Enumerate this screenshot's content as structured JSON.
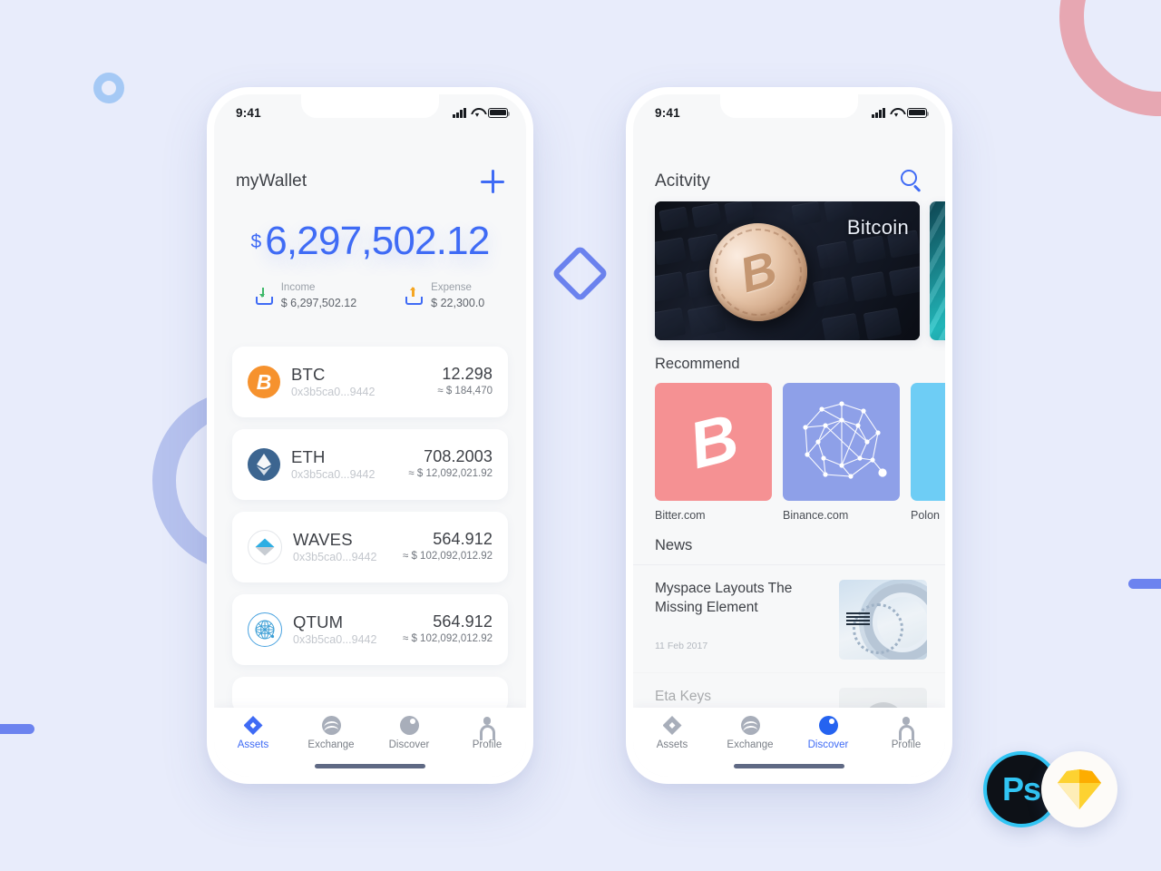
{
  "phone1": {
    "status": {
      "time": "9:41",
      "signal_icon": "cellular-bars-icon",
      "wifi_icon": "wifi-icon",
      "battery_icon": "battery-full-icon"
    },
    "header": {
      "title": "myWallet",
      "add_icon": "plus-icon"
    },
    "balance": {
      "currency_symbol": "$",
      "amount": "6,297,502.12"
    },
    "summary": [
      {
        "icon": "income-download-icon",
        "label": "Income",
        "value": "$ 6,297,502.12"
      },
      {
        "icon": "expense-upload-icon",
        "label": "Expense",
        "value": "$ 22,300.0"
      }
    ],
    "assets": [
      {
        "icon": "bitcoin-coin-icon",
        "symbol": "BTC",
        "address": "0x3b5ca0...9442",
        "amount": "12.298",
        "usd": "≈ $ 184,470"
      },
      {
        "icon": "ethereum-coin-icon",
        "symbol": "ETH",
        "address": "0x3b5ca0...9442",
        "amount": "708.2003",
        "usd": "≈ $ 12,092,021.92"
      },
      {
        "icon": "waves-coin-icon",
        "symbol": "WAVES",
        "address": "0x3b5ca0...9442",
        "amount": "564.912",
        "usd": "≈ $ 102,092,012.92"
      },
      {
        "icon": "qtum-coin-icon",
        "symbol": "QTUM",
        "address": "0x3b5ca0...9442",
        "amount": "564.912",
        "usd": "≈ $ 102,092,012.92"
      }
    ],
    "tabs": [
      {
        "icon": "assets-diamond-icon",
        "label": "Assets",
        "active": true
      },
      {
        "icon": "exchange-waves-icon",
        "label": "Exchange",
        "active": false
      },
      {
        "icon": "discover-compass-icon",
        "label": "Discover",
        "active": false
      },
      {
        "icon": "profile-person-icon",
        "label": "Profile",
        "active": false
      }
    ]
  },
  "phone2": {
    "status": {
      "time": "9:41",
      "signal_icon": "cellular-bars-icon",
      "wifi_icon": "wifi-icon",
      "battery_icon": "battery-full-icon"
    },
    "header": {
      "title": "Acitvity",
      "search_icon": "search-icon"
    },
    "hero": [
      {
        "caption": "Bitcoin",
        "image": "bitcoin-coin-on-keyboard-photo"
      },
      {
        "caption": "",
        "image": "teal-abstract-photo"
      }
    ],
    "recommend": {
      "section_title": "Recommend",
      "items": [
        {
          "icon": "bitcoin-glyph-icon",
          "label": "Bitter.com",
          "color": "#f59193"
        },
        {
          "icon": "network-mesh-icon",
          "label": "Binance.com",
          "color": "#8ea0e8"
        },
        {
          "icon": "poloniex-icon",
          "label": "Polon",
          "color": "#6ecdf5"
        }
      ]
    },
    "news": {
      "section_title": "News",
      "items": [
        {
          "title": "Myspace Layouts The Missing Element",
          "date": "11 Feb 2017",
          "thumb": "ibm-server-ring-photo"
        },
        {
          "title": "Eta Keys",
          "date": "",
          "thumb": "person-portrait-photo"
        }
      ]
    },
    "tabs": [
      {
        "icon": "assets-diamond-icon",
        "label": "Assets",
        "active": false
      },
      {
        "icon": "exchange-waves-icon",
        "label": "Exchange",
        "active": false
      },
      {
        "icon": "discover-compass-icon",
        "label": "Discover",
        "active": true
      },
      {
        "icon": "profile-person-icon",
        "label": "Profile",
        "active": false
      }
    ]
  },
  "decor": {
    "ring_small_color": "#a5c9f5",
    "arc_purple_color": "#b6c2ee",
    "arc_pink_color": "#e7a7b2",
    "diamond_color": "#6c83ef",
    "bar_color": "#6c83ef",
    "background_color": "#e8ecfb",
    "accent_blue": "#3f6bf5"
  },
  "badges": [
    {
      "name": "photoshop-badge",
      "label": "Ps"
    },
    {
      "name": "sketch-badge",
      "label": "sketch-diamond-icon"
    }
  ]
}
